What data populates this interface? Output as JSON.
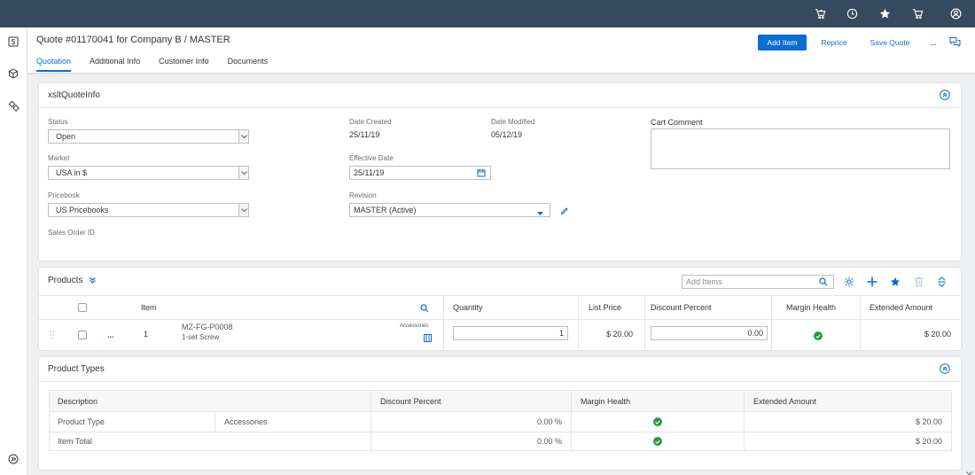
{
  "header": {
    "title": "Quote #01170041 for Company B / MASTER",
    "tabs": [
      "Quotation",
      "Additional Info",
      "Customer Info",
      "Documents"
    ],
    "add_item_label": "Add Item",
    "reprice_label": "Reprice",
    "save_quote_label": "Save Quote",
    "more_label": "..."
  },
  "quote_info": {
    "title": "xsltQuoteInfo",
    "status_label": "Status",
    "status_value": "Open",
    "market_label": "Market",
    "market_value": "USA in $",
    "pricebook_label": "Pricebook",
    "pricebook_value": "US Pricebooks",
    "sales_order_label": "Sales Order ID",
    "date_created_label": "Date Created",
    "date_created_value": "25/11/19",
    "date_modified_label": "Date Modified",
    "date_modified_value": "05/12/19",
    "effective_date_label": "Effective Date",
    "effective_date_value": "25/11/19",
    "revision_label": "Revision",
    "revision_value": "MASTER (Active)",
    "cart_comment_label": "Cart Comment"
  },
  "products": {
    "title": "Products",
    "add_items_placeholder": "Add Items",
    "columns": {
      "item": "Item",
      "quantity": "Quantity",
      "list_price": "List Price",
      "discount_percent": "Discount Percent",
      "margin_health": "Margin Health",
      "extended_amount": "Extended Amount"
    },
    "rows": [
      {
        "more": "...",
        "num": "1",
        "part_number": "MZ-FG-P0008",
        "description": "1-set Screw",
        "tag": "Accessories",
        "quantity": "1",
        "list_price": "$ 20.00",
        "discount": "0.00",
        "extended_amount": "$ 20.00"
      }
    ]
  },
  "product_types": {
    "title": "Product Types",
    "columns": {
      "description": "Description",
      "discount_percent": "Discount Percent",
      "margin_health": "Margin Health",
      "extended_amount": "Extended Amount"
    },
    "rows": [
      {
        "description": "Product Type",
        "category": "Accessories",
        "discount": "0.00 %",
        "amount": "$ 20.00"
      },
      {
        "description": "Item Total",
        "category": "",
        "discount": "0.00 %",
        "amount": "$ 20.00"
      }
    ]
  },
  "colors": {
    "shell": "#354a5f",
    "accent": "#0a6ed1",
    "success": "#2b9b3e"
  }
}
